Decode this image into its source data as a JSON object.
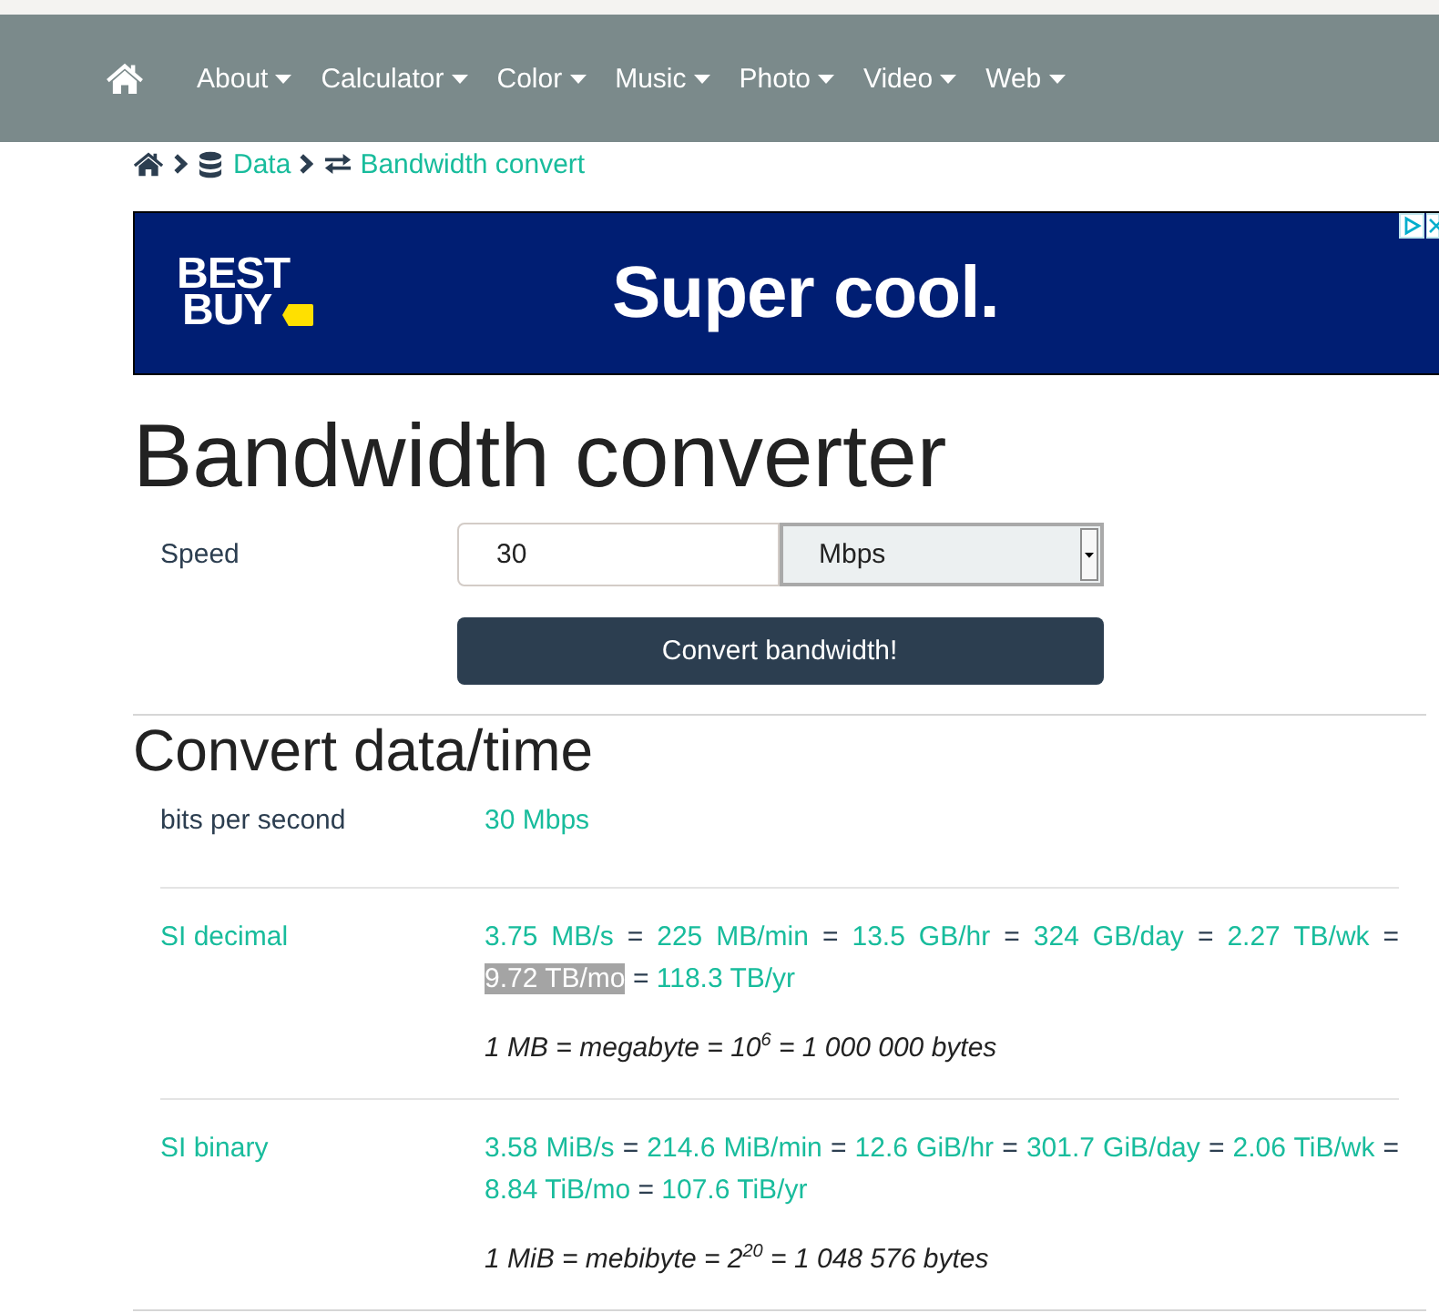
{
  "navbar": {
    "items": [
      {
        "label": "About"
      },
      {
        "label": "Calculator"
      },
      {
        "label": "Color"
      },
      {
        "label": "Music"
      },
      {
        "label": "Photo"
      },
      {
        "label": "Video"
      },
      {
        "label": "Web"
      }
    ]
  },
  "breadcrumb": [
    {
      "label": "Data"
    },
    {
      "label": "Bandwidth convert"
    }
  ],
  "ad": {
    "logo_lines": [
      "BEST",
      "BUY"
    ],
    "headline": "Super cool."
  },
  "title": "Bandwidth converter",
  "form": {
    "label": "Speed",
    "value": "30",
    "unit": "Mbps",
    "button": "Convert bandwidth!"
  },
  "results": {
    "title": "Convert data/time",
    "rows": [
      {
        "label": "bits per second",
        "linked": false,
        "parts": [
          {
            "kind": "link",
            "text": "30 Mbps",
            "highlighted": false
          }
        ]
      },
      {
        "label": "SI decimal",
        "linked": true,
        "parts": [
          {
            "kind": "link",
            "text": "3.75 MB/s",
            "highlighted": false
          },
          {
            "kind": "sign",
            "text": "=",
            "highlighted": false
          },
          {
            "kind": "link",
            "text": "225 MB/min",
            "highlighted": false
          },
          {
            "kind": "sign",
            "text": "=",
            "highlighted": false
          },
          {
            "kind": "link",
            "text": "13.5 GB/hr",
            "highlighted": false
          },
          {
            "kind": "sign",
            "text": "=",
            "highlighted": false
          },
          {
            "kind": "link",
            "text": "324 GB/day",
            "highlighted": false
          },
          {
            "kind": "sign",
            "text": "=",
            "highlighted": false
          },
          {
            "kind": "link",
            "text": "2.27 TB/wk",
            "highlighted": false
          },
          {
            "kind": "sign",
            "text": "=",
            "highlighted": false
          },
          {
            "kind": "link",
            "text": "9.72 TB/mo",
            "highlighted": true
          },
          {
            "kind": "sign",
            "text": "=",
            "highlighted": false
          },
          {
            "kind": "link",
            "text": "118.3 TB/yr",
            "highlighted": false
          }
        ],
        "note": "1 MB = megabyte = 10$^{6}$ = 1 000 000 bytes"
      },
      {
        "label": "SI binary",
        "linked": true,
        "parts": [
          {
            "kind": "link",
            "text": "3.58 MiB/s",
            "highlighted": false
          },
          {
            "kind": "sign",
            "text": "=",
            "highlighted": false
          },
          {
            "kind": "link",
            "text": "214.6 MiB/min",
            "highlighted": false
          },
          {
            "kind": "sign",
            "text": "=",
            "highlighted": false
          },
          {
            "kind": "link",
            "text": "12.6 GiB/hr",
            "highlighted": false
          },
          {
            "kind": "sign",
            "text": "=",
            "highlighted": false
          },
          {
            "kind": "link",
            "text": "301.7 GiB/day",
            "highlighted": false
          },
          {
            "kind": "sign",
            "text": "=",
            "highlighted": false
          },
          {
            "kind": "link",
            "text": "2.06 TiB/wk",
            "highlighted": false
          },
          {
            "kind": "sign",
            "text": "=",
            "highlighted": false
          },
          {
            "kind": "link",
            "text": "8.84 TiB/mo",
            "highlighted": false
          },
          {
            "kind": "sign",
            "text": "=",
            "highlighted": false
          },
          {
            "kind": "link",
            "text": "107.6 TiB/yr",
            "highlighted": false
          }
        ],
        "note": "1 MiB = mebibyte = 2$^{20}$ = 1 048 576 bytes"
      }
    ]
  }
}
